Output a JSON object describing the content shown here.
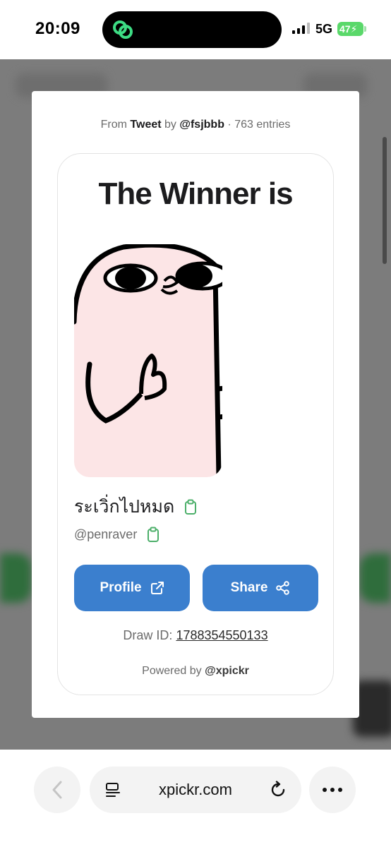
{
  "status_bar": {
    "time": "20:09",
    "network": "5G",
    "battery": "47"
  },
  "modal": {
    "meta": {
      "from": "From",
      "source": "Tweet",
      "by": "by",
      "author": "@fsjbbb",
      "separator": "·",
      "entries": "763 entries"
    },
    "title": "The Winner is",
    "winner": {
      "display_name": "ระเวิ่กไปหมด",
      "handle": "@penraver"
    },
    "buttons": {
      "profile": "Profile",
      "share": "Share"
    },
    "draw_label": "Draw ID:",
    "draw_id": "1788354550133",
    "powered_label": "Powered by",
    "powered_brand": "@xpickr"
  },
  "browser": {
    "url": "xpickr.com"
  },
  "colors": {
    "accent": "#3b7fce",
    "copy_icon": "#4caf6a",
    "battery": "#5ad86a"
  }
}
